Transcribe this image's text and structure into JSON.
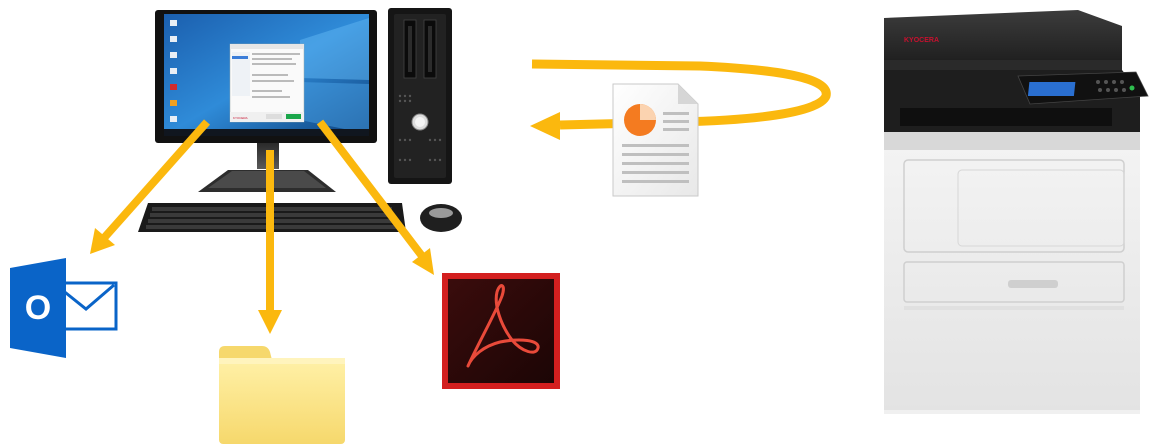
{
  "diagram": {
    "description_free": true,
    "printer": {
      "brand_mark": "KYOCERA",
      "brand_color": "#c8102e"
    },
    "desktop_app": {
      "brand_mark": "KYOCERA"
    },
    "colors": {
      "arrow": "#fbb80e",
      "outlook_blue": "#0a64c8",
      "acrobat_red": "#d31f1f",
      "acrobat_dark": "#2a0a0a",
      "folder": "#fbe38c",
      "document_accent": "#f47b20"
    },
    "icons": [
      "desktop-computer-icon",
      "tower-pc-icon",
      "keyboard-icon",
      "mouse-icon",
      "scanned-document-icon",
      "multifunction-printer-icon",
      "outlook-email-icon",
      "folder-icon",
      "acrobat-pdf-icon"
    ],
    "outlook_letter": "O"
  }
}
